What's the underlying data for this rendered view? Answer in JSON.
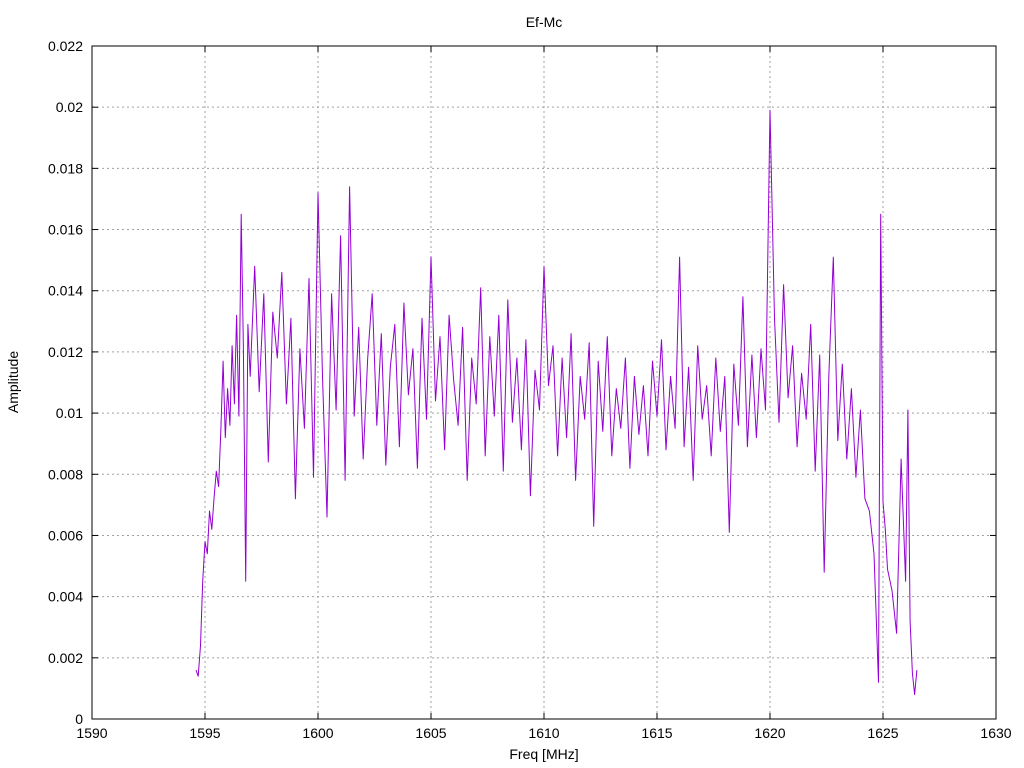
{
  "chart_data": {
    "type": "line",
    "title": "Ef-Mc",
    "xlabel": "Freq [MHz]",
    "ylabel": "Amplitude",
    "xlim": [
      1590,
      1630
    ],
    "ylim": [
      0,
      0.022
    ],
    "x_ticks": [
      1590,
      1595,
      1600,
      1605,
      1610,
      1615,
      1620,
      1625,
      1630
    ],
    "y_ticks": [
      0,
      0.002,
      0.004,
      0.006,
      0.008,
      0.01,
      0.012,
      0.014,
      0.016,
      0.018,
      0.02,
      0.022
    ],
    "grid": true,
    "legend": "none",
    "series_color": "#9400d3",
    "series": [
      {
        "x": [
          1594.6,
          1594.7,
          1594.8,
          1594.9,
          1595.0,
          1595.1,
          1595.2,
          1595.3,
          1595.4,
          1595.5,
          1595.6,
          1595.7,
          1595.8,
          1595.9,
          1596.0,
          1596.1,
          1596.2,
          1596.3,
          1596.4,
          1596.5,
          1596.6,
          1596.7,
          1596.8,
          1596.9,
          1597.0,
          1597.2,
          1597.4,
          1597.6,
          1597.8,
          1598.0,
          1598.2,
          1598.4,
          1598.6,
          1598.8,
          1599.0,
          1599.2,
          1599.4,
          1599.6,
          1599.8,
          1600.0,
          1600.2,
          1600.4,
          1600.6,
          1600.8,
          1601.0,
          1601.2,
          1601.4,
          1601.6,
          1601.8,
          1602.0,
          1602.2,
          1602.4,
          1602.6,
          1602.8,
          1603.0,
          1603.2,
          1603.4,
          1603.6,
          1603.8,
          1604.0,
          1604.2,
          1604.4,
          1604.6,
          1604.8,
          1605.0,
          1605.2,
          1605.4,
          1605.6,
          1605.8,
          1606.0,
          1606.2,
          1606.4,
          1606.6,
          1606.8,
          1607.0,
          1607.2,
          1607.4,
          1607.6,
          1607.8,
          1608.0,
          1608.2,
          1608.4,
          1608.6,
          1608.8,
          1609.0,
          1609.2,
          1609.4,
          1609.6,
          1609.8,
          1610.0,
          1610.2,
          1610.4,
          1610.6,
          1610.8,
          1611.0,
          1611.2,
          1611.4,
          1611.6,
          1611.8,
          1612.0,
          1612.2,
          1612.4,
          1612.6,
          1612.8,
          1613.0,
          1613.2,
          1613.4,
          1613.6,
          1613.8,
          1614.0,
          1614.2,
          1614.4,
          1614.6,
          1614.8,
          1615.0,
          1615.2,
          1615.4,
          1615.6,
          1615.8,
          1616.0,
          1616.2,
          1616.4,
          1616.6,
          1616.8,
          1617.0,
          1617.2,
          1617.4,
          1617.6,
          1617.8,
          1618.0,
          1618.2,
          1618.4,
          1618.6,
          1618.8,
          1619.0,
          1619.2,
          1619.4,
          1619.6,
          1619.8,
          1620.0,
          1620.2,
          1620.4,
          1620.6,
          1620.8,
          1621.0,
          1621.2,
          1621.4,
          1621.6,
          1621.8,
          1622.0,
          1622.2,
          1622.4,
          1622.6,
          1622.8,
          1623.0,
          1623.2,
          1623.4,
          1623.6,
          1623.8,
          1624.0,
          1624.2,
          1624.4,
          1624.6,
          1624.8,
          1624.9,
          1625.0,
          1625.1,
          1625.2,
          1625.4,
          1625.6,
          1625.8,
          1626.0,
          1626.1,
          1626.2,
          1626.3,
          1626.4,
          1626.5
        ],
        "y": [
          0.0016,
          0.0014,
          0.0024,
          0.0045,
          0.0058,
          0.0054,
          0.0068,
          0.0062,
          0.0072,
          0.0081,
          0.0076,
          0.0094,
          0.0117,
          0.0092,
          0.0108,
          0.0096,
          0.0122,
          0.0103,
          0.0132,
          0.0099,
          0.0165,
          0.0121,
          0.0045,
          0.0129,
          0.0112,
          0.0148,
          0.0107,
          0.0139,
          0.0084,
          0.0133,
          0.0118,
          0.0146,
          0.0103,
          0.0131,
          0.0072,
          0.0121,
          0.0095,
          0.0144,
          0.0079,
          0.0172,
          0.0112,
          0.0066,
          0.0139,
          0.0101,
          0.0158,
          0.0078,
          0.0174,
          0.0099,
          0.0128,
          0.0085,
          0.0118,
          0.0139,
          0.0096,
          0.0126,
          0.0083,
          0.0115,
          0.0129,
          0.0089,
          0.0136,
          0.0106,
          0.0121,
          0.0082,
          0.0131,
          0.0098,
          0.0151,
          0.0104,
          0.0125,
          0.0088,
          0.0132,
          0.0111,
          0.0096,
          0.0128,
          0.0078,
          0.0118,
          0.0103,
          0.0141,
          0.0086,
          0.0125,
          0.0099,
          0.0132,
          0.0081,
          0.0137,
          0.0097,
          0.0118,
          0.0088,
          0.0124,
          0.0073,
          0.0114,
          0.0101,
          0.0148,
          0.0109,
          0.0122,
          0.0086,
          0.0118,
          0.0092,
          0.0126,
          0.0078,
          0.0112,
          0.0098,
          0.0123,
          0.0063,
          0.0117,
          0.0094,
          0.0125,
          0.0086,
          0.0108,
          0.0095,
          0.0118,
          0.0082,
          0.0112,
          0.0093,
          0.0109,
          0.0086,
          0.0117,
          0.0099,
          0.0124,
          0.0088,
          0.0112,
          0.0095,
          0.0151,
          0.0089,
          0.0115,
          0.0078,
          0.0122,
          0.0098,
          0.0109,
          0.0086,
          0.0118,
          0.0094,
          0.0112,
          0.0061,
          0.0116,
          0.0096,
          0.0138,
          0.0089,
          0.0119,
          0.0092,
          0.0121,
          0.0101,
          0.0199,
          0.0131,
          0.0097,
          0.0142,
          0.0105,
          0.0122,
          0.0089,
          0.0113,
          0.0098,
          0.0129,
          0.0081,
          0.0119,
          0.0048,
          0.0112,
          0.0151,
          0.0091,
          0.0116,
          0.0085,
          0.0108,
          0.0079,
          0.0101,
          0.0072,
          0.0068,
          0.0054,
          0.0012,
          0.0165,
          0.0071,
          0.0062,
          0.0049,
          0.0042,
          0.0028,
          0.0085,
          0.0045,
          0.0101,
          0.0032,
          0.0015,
          0.0008,
          0.0016
        ]
      }
    ]
  }
}
